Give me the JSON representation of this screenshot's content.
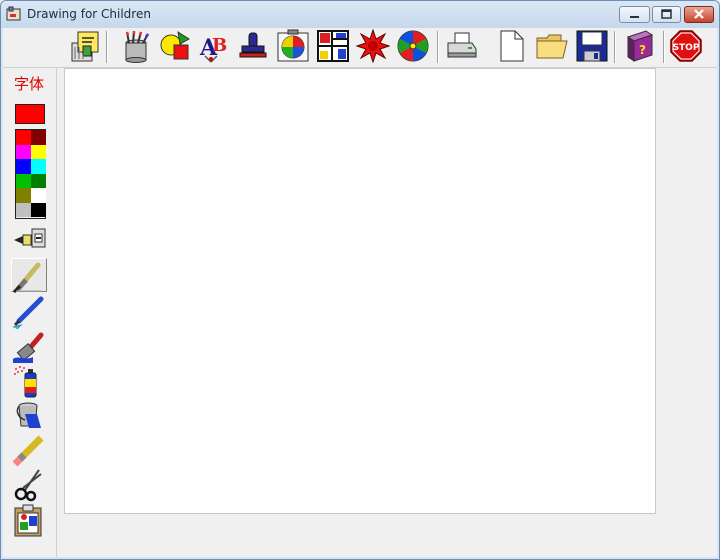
{
  "window": {
    "title": "Drawing for Children"
  },
  "toolbar": {
    "buttons": [
      {
        "name": "clear-all-icon"
      },
      {
        "name": "paint-cans-icon"
      },
      {
        "name": "shapes-icon"
      },
      {
        "name": "text-tool-icon"
      },
      {
        "name": "stamp-icon"
      },
      {
        "name": "fill-pattern-icon"
      },
      {
        "name": "mondrian-frame-icon"
      },
      {
        "name": "starburst-icon"
      },
      {
        "name": "pinwheel-icon"
      },
      {
        "name": "print-icon"
      },
      {
        "name": "new-file-icon"
      },
      {
        "name": "open-folder-icon"
      },
      {
        "name": "save-disk-icon"
      },
      {
        "name": "help-book-icon"
      },
      {
        "name": "stop-sign-icon"
      }
    ],
    "help_glyph": "?",
    "stop_label": "STOP",
    "text_glyph_a": "A",
    "text_glyph_b": "B"
  },
  "left_panel": {
    "font_label": "字体",
    "current_color": "#ff0000",
    "palette": [
      "#ff0000",
      "#800000",
      "#ff00ff",
      "#ffff00",
      "#0000ff",
      "#00ffff",
      "#00c000",
      "#008000",
      "#808000",
      "#ffffff",
      "#c0c0c0",
      "#000000"
    ],
    "tools": [
      {
        "name": "brush-size-icon",
        "active": false
      },
      {
        "name": "paint-brush-icon",
        "active": true
      },
      {
        "name": "pencil-icon",
        "active": false
      },
      {
        "name": "wide-brush-icon",
        "active": false
      },
      {
        "name": "spray-can-icon",
        "active": false
      },
      {
        "name": "paint-bucket-icon",
        "active": false
      },
      {
        "name": "eraser-pencil-icon",
        "active": false
      },
      {
        "name": "scissors-icon",
        "active": false
      },
      {
        "name": "clipboard-icon",
        "active": false
      }
    ]
  },
  "colors": {
    "canvas": "#ffffff",
    "panel": "#f0f0f0"
  }
}
